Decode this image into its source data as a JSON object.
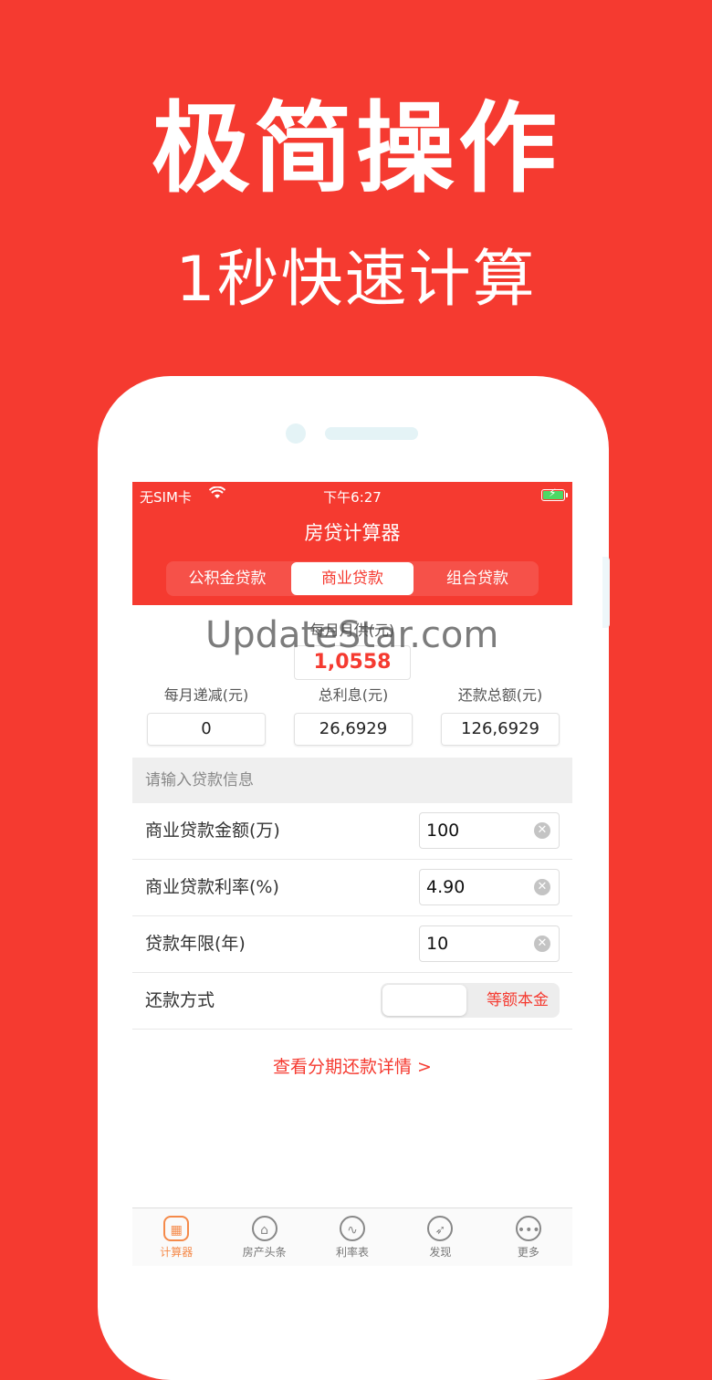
{
  "hero": {
    "title": "极简操作",
    "subtitle": "1秒快速计算"
  },
  "status_bar": {
    "carrier": "无SIM卡",
    "time": "下午6:27"
  },
  "nav": {
    "title": "房贷计算器"
  },
  "segments": [
    "公积金贷款",
    "商业贷款",
    "组合贷款"
  ],
  "segment_selected": "商业贷款",
  "watermark": "UpdateStar.com",
  "results": {
    "monthly_label": "每月月供(元)",
    "monthly_value": "1,0558",
    "cols": [
      {
        "label": "每月递减(元)",
        "value": "0"
      },
      {
        "label": "总利息(元)",
        "value": "26,6929"
      },
      {
        "label": "还款总额(元)",
        "value": "126,6929"
      }
    ]
  },
  "form": {
    "section_title": "请输入贷款信息",
    "amount": {
      "label": "商业贷款金额(万)",
      "value": "100"
    },
    "rate": {
      "label": "商业贷款利率(%)",
      "value": "4.90"
    },
    "years": {
      "label": "贷款年限(年)",
      "value": "10"
    },
    "method": {
      "label": "还款方式",
      "option": "等额本金"
    }
  },
  "detail_link": "查看分期还款详情 >",
  "tabs": [
    "计算器",
    "房产头条",
    "利率表",
    "发现",
    "更多"
  ],
  "colors": {
    "brand_red": "#f53a30",
    "tab_active": "#f58a4a"
  }
}
